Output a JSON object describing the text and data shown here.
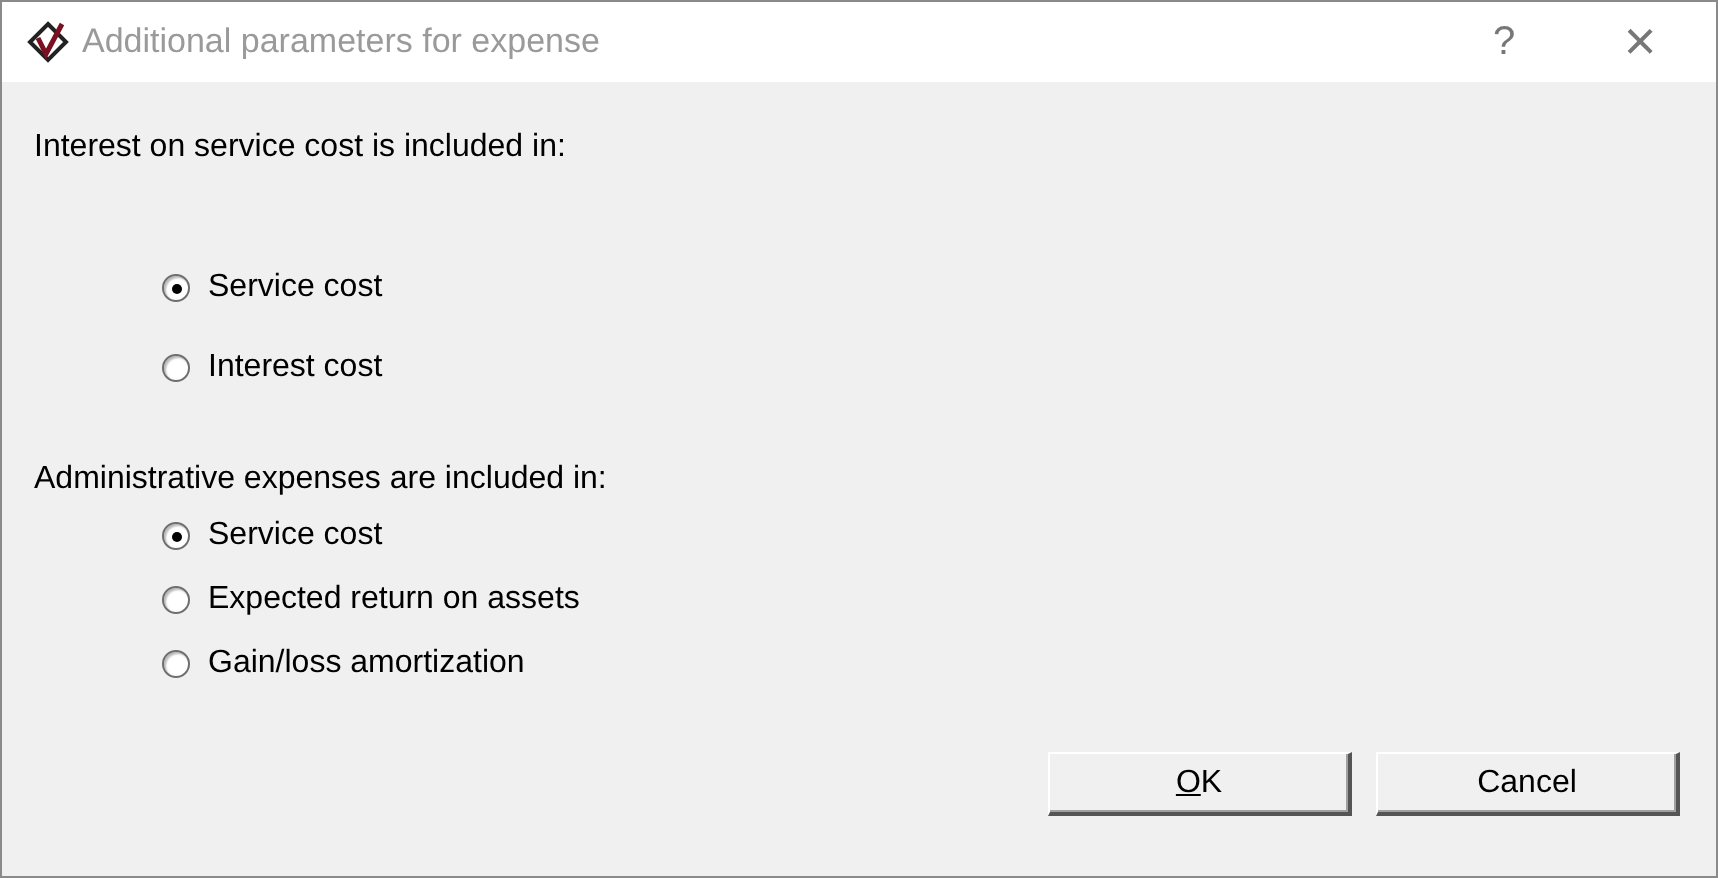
{
  "window": {
    "title": "Additional parameters for expense",
    "help": "?",
    "close": "×"
  },
  "groups": [
    {
      "label": "Interest on service cost is included in:",
      "options": [
        {
          "label": "Service cost",
          "selected": true
        },
        {
          "label": "Interest cost",
          "selected": false
        }
      ]
    },
    {
      "label": "Administrative expenses are included in:",
      "options": [
        {
          "label": "Service cost",
          "selected": true
        },
        {
          "label": "Expected return on assets",
          "selected": false
        },
        {
          "label": "Gain/loss amortization",
          "selected": false
        }
      ]
    }
  ],
  "buttons": [
    {
      "label": "OK",
      "mnemonic_underlined": true
    },
    {
      "label": "Cancel",
      "mnemonic_underlined": false
    }
  ]
}
